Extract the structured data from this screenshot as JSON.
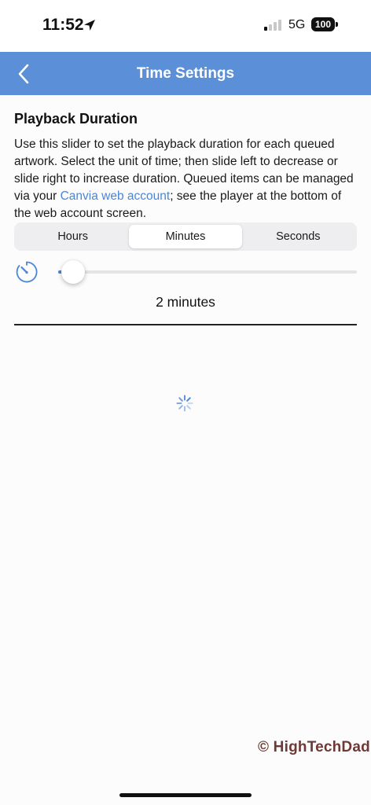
{
  "status_bar": {
    "time": "11:52",
    "network": "5G",
    "battery": "100",
    "icons": [
      "location-arrow-icon",
      "signal-icon",
      "battery-icon"
    ]
  },
  "nav": {
    "title": "Time Settings",
    "back_icon": "chevron-left-icon"
  },
  "playback": {
    "title": "Playback Duration",
    "description_before": "Use this slider to set the playback duration for each queued artwork. Select the unit of time; then slide left to decrease or slide right to increase duration. Queued items can be managed via your ",
    "link_text": "Canvia web account",
    "description_after": "; see the player at the bottom of the web account screen.",
    "units": [
      {
        "label": "Hours",
        "selected": false
      },
      {
        "label": "Minutes",
        "selected": true
      },
      {
        "label": "Seconds",
        "selected": false
      }
    ],
    "slider_fraction": 0.05,
    "timer_icon": "timer-icon",
    "duration_text": "2 minutes"
  },
  "loading_icon": "spinner-icon",
  "watermark": "© HighTechDad",
  "colors": {
    "nav_background": "#5b8fd7",
    "accent": "#4a86d6",
    "watermark": "#6d3a36"
  }
}
